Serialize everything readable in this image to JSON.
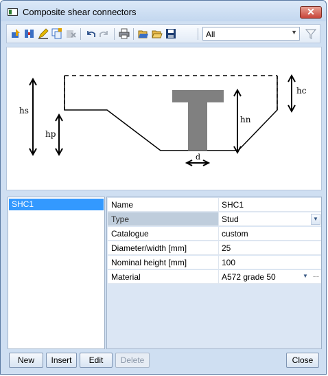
{
  "window": {
    "title": "Composite shear connectors",
    "close_glyph": "✕"
  },
  "toolbar": {
    "icons": [
      "insert-row-icon",
      "columns-icon",
      "edit-pencil-icon",
      "copy-icon",
      "delete-disabled-icon",
      "undo-icon",
      "redo-disabled-icon",
      "print-icon",
      "open-folder-icon",
      "open-folder-2-icon",
      "save-icon"
    ],
    "filter_value": "All",
    "filter_icon": "funnel-icon"
  },
  "diagram": {
    "labels": {
      "hs": "hs",
      "hp": "hp",
      "hn": "hn",
      "hc": "hc",
      "d": "d"
    }
  },
  "list": {
    "items": [
      "SHC1"
    ]
  },
  "properties": [
    {
      "name": "Name",
      "value": "SHC1"
    },
    {
      "name": "Type",
      "value": "Stud"
    },
    {
      "name": "Catalogue",
      "value": "custom"
    },
    {
      "name": "Diameter/width [mm]",
      "value": "25"
    },
    {
      "name": "Nominal height [mm]",
      "value": "100"
    },
    {
      "name": "Material",
      "value": "A572 grade 50"
    }
  ],
  "buttons": {
    "new": "New",
    "insert": "Insert",
    "edit": "Edit",
    "delete": "Delete",
    "close": "Close"
  },
  "colors": {
    "selection": "#3399ff",
    "stud": "#808080",
    "title_bg": "#c3d7ef"
  }
}
